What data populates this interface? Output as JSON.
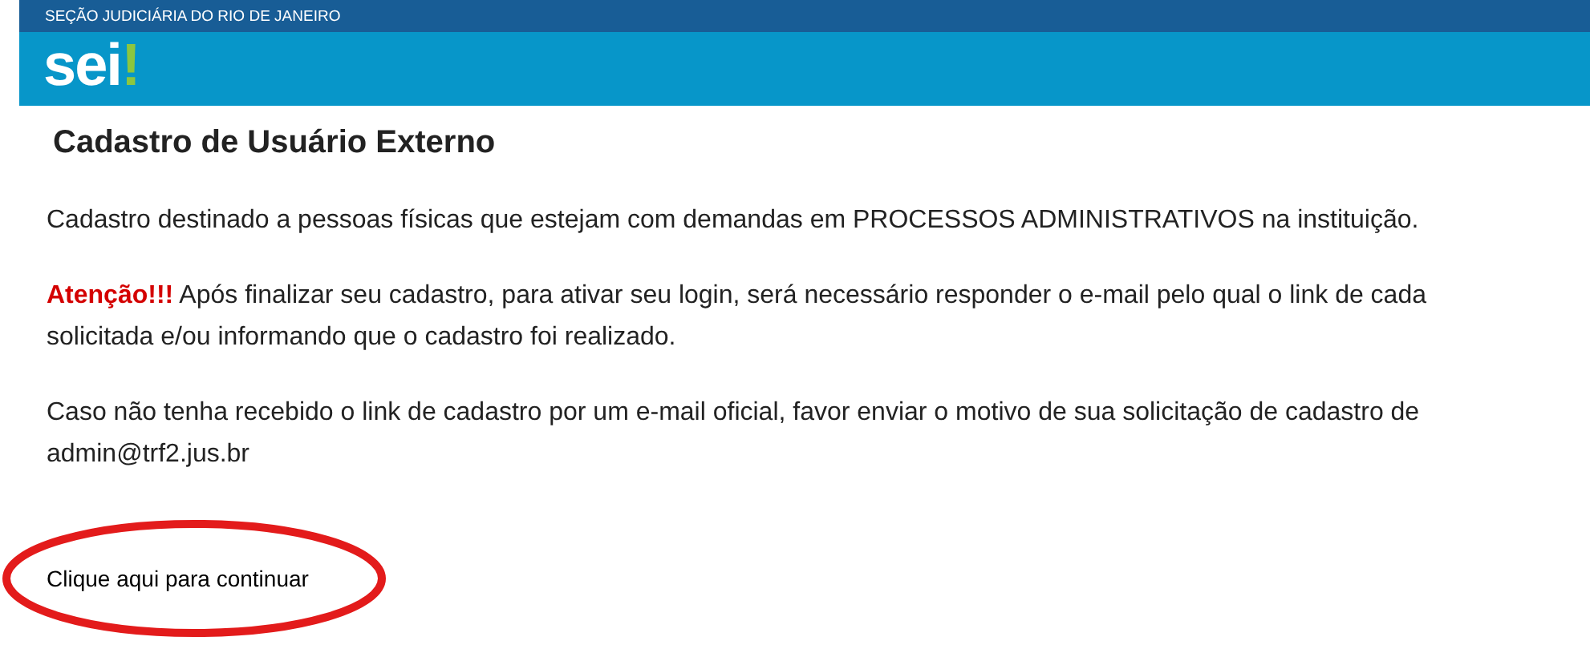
{
  "header": {
    "agency": "SEÇÃO JUDICIÁRIA DO RIO DE JANEIRO",
    "logo": {
      "text": "sei",
      "mark": "!"
    }
  },
  "title": "Cadastro de Usuário Externo",
  "paragraphs": [
    {
      "lines": [
        "Cadastro destinado a pessoas físicas que estejam com demandas em PROCESSOS ADMINISTRATIVOS na instituição."
      ]
    },
    {
      "alert": "Atenção!!!",
      "lines": [
        " Após finalizar seu cadastro, para ativar seu login, será necessário responder o e-mail pelo qual o link de cada",
        "solicitada e/ou informando que o cadastro foi realizado."
      ]
    },
    {
      "lines": [
        "Caso não tenha recebido o link de cadastro por um e-mail oficial, favor enviar o motivo de sua solicitação de cadastro de",
        "admin@trf2.jus.br"
      ]
    }
  ],
  "continue_link": "Clique aqui para continuar"
}
